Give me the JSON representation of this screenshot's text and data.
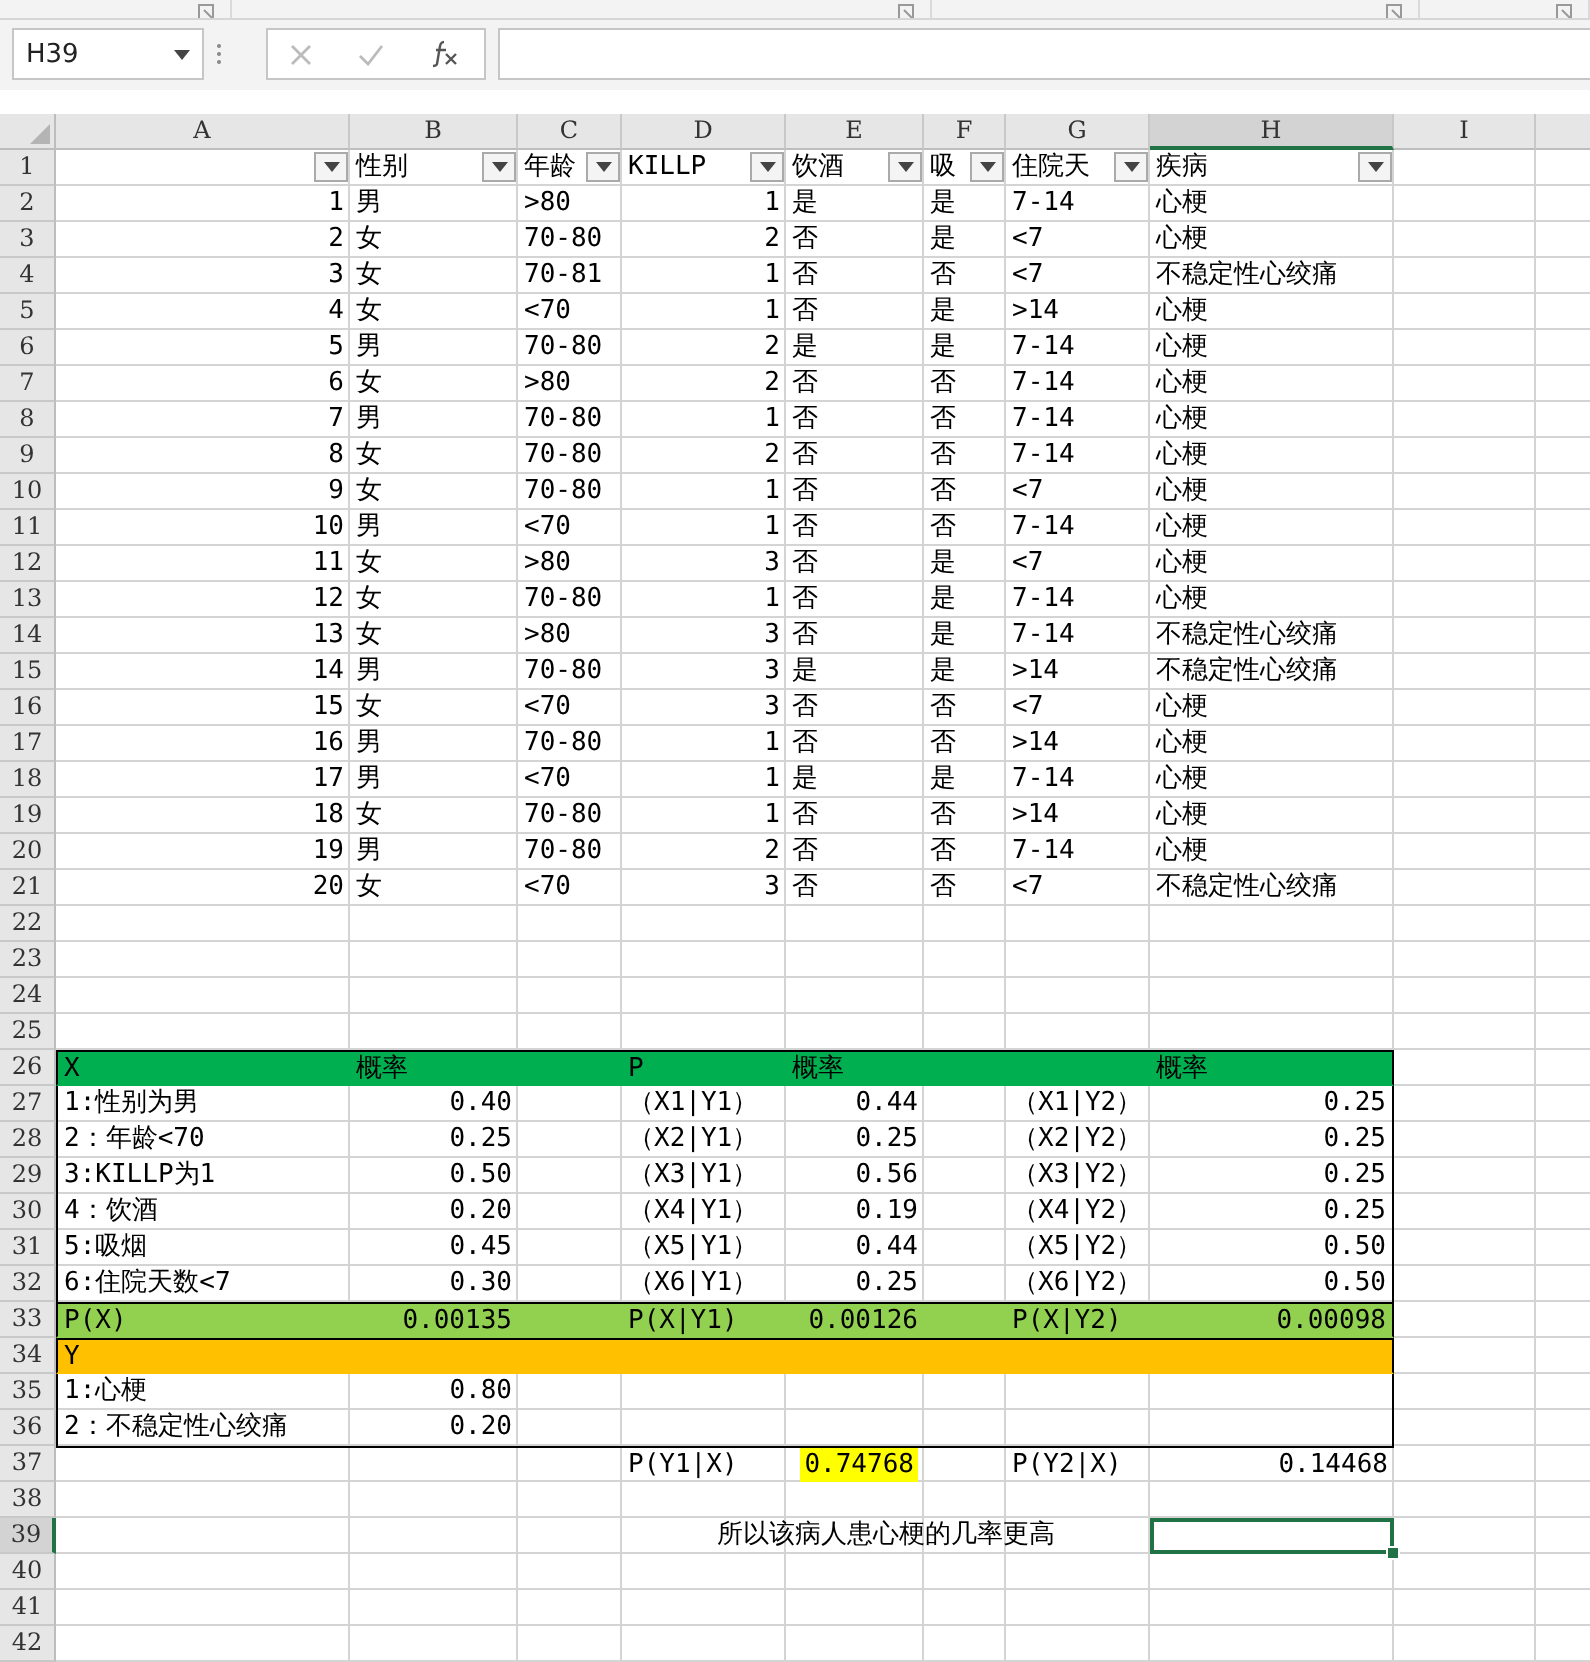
{
  "name_box": "H39",
  "columns": [
    {
      "letter": "A",
      "filter": true,
      "selected": false
    },
    {
      "letter": "B",
      "filter": true,
      "selected": false
    },
    {
      "letter": "C",
      "filter": true,
      "selected": false
    },
    {
      "letter": "D",
      "filter": true,
      "selected": false
    },
    {
      "letter": "E",
      "filter": true,
      "selected": false
    },
    {
      "letter": "F",
      "filter": true,
      "selected": false
    },
    {
      "letter": "G",
      "filter": true,
      "selected": false
    },
    {
      "letter": "H",
      "filter": true,
      "selected": true
    },
    {
      "letter": "I",
      "filter": false,
      "selected": false
    }
  ],
  "rows": [
    {
      "n": "1",
      "kind": "header",
      "selected": false,
      "cells": {
        "B": "性别",
        "C": "年龄",
        "D": "KILLP",
        "E": "饮酒",
        "F": "吸",
        "G": "住院天",
        "H": "疾病"
      }
    },
    {
      "n": "2",
      "kind": "record",
      "selected": false,
      "cells": {
        "A": "1",
        "B": "男",
        "C": ">80",
        "D": "1",
        "E": "是",
        "F": "是",
        "G": "7-14",
        "H": "心梗"
      }
    },
    {
      "n": "3",
      "kind": "record",
      "selected": false,
      "cells": {
        "A": "2",
        "B": "女",
        "C": "70-80",
        "D": "2",
        "E": "否",
        "F": "是",
        "G": "<7",
        "H": "心梗"
      }
    },
    {
      "n": "4",
      "kind": "record",
      "selected": false,
      "cells": {
        "A": "3",
        "B": "女",
        "C": "70-81",
        "D": "1",
        "E": "否",
        "F": "否",
        "G": "<7",
        "H": "不稳定性心绞痛"
      }
    },
    {
      "n": "5",
      "kind": "record",
      "selected": false,
      "cells": {
        "A": "4",
        "B": "女",
        "C": "<70",
        "D": "1",
        "E": "否",
        "F": "是",
        "G": ">14",
        "H": "心梗"
      }
    },
    {
      "n": "6",
      "kind": "record",
      "selected": false,
      "cells": {
        "A": "5",
        "B": "男",
        "C": "70-80",
        "D": "2",
        "E": "是",
        "F": "是",
        "G": "7-14",
        "H": "心梗"
      }
    },
    {
      "n": "7",
      "kind": "record",
      "selected": false,
      "cells": {
        "A": "6",
        "B": "女",
        "C": ">80",
        "D": "2",
        "E": "否",
        "F": "否",
        "G": "7-14",
        "H": "心梗"
      }
    },
    {
      "n": "8",
      "kind": "record",
      "selected": false,
      "cells": {
        "A": "7",
        "B": "男",
        "C": "70-80",
        "D": "1",
        "E": "否",
        "F": "否",
        "G": "7-14",
        "H": "心梗"
      }
    },
    {
      "n": "9",
      "kind": "record",
      "selected": false,
      "cells": {
        "A": "8",
        "B": "女",
        "C": "70-80",
        "D": "2",
        "E": "否",
        "F": "否",
        "G": "7-14",
        "H": "心梗"
      }
    },
    {
      "n": "10",
      "kind": "record",
      "selected": false,
      "cells": {
        "A": "9",
        "B": "女",
        "C": "70-80",
        "D": "1",
        "E": "否",
        "F": "否",
        "G": "<7",
        "H": "心梗"
      }
    },
    {
      "n": "11",
      "kind": "record",
      "selected": false,
      "cells": {
        "A": "10",
        "B": "男",
        "C": "<70",
        "D": "1",
        "E": "否",
        "F": "否",
        "G": "7-14",
        "H": "心梗"
      }
    },
    {
      "n": "12",
      "kind": "record",
      "selected": false,
      "cells": {
        "A": "11",
        "B": "女",
        "C": ">80",
        "D": "3",
        "E": "否",
        "F": "是",
        "G": "<7",
        "H": "心梗"
      }
    },
    {
      "n": "13",
      "kind": "record",
      "selected": false,
      "cells": {
        "A": "12",
        "B": "女",
        "C": "70-80",
        "D": "1",
        "E": "否",
        "F": "是",
        "G": "7-14",
        "H": "心梗"
      }
    },
    {
      "n": "14",
      "kind": "record",
      "selected": false,
      "cells": {
        "A": "13",
        "B": "女",
        "C": ">80",
        "D": "3",
        "E": "否",
        "F": "是",
        "G": "7-14",
        "H": "不稳定性心绞痛"
      }
    },
    {
      "n": "15",
      "kind": "record",
      "selected": false,
      "cells": {
        "A": "14",
        "B": "男",
        "C": "70-80",
        "D": "3",
        "E": "是",
        "F": "是",
        "G": ">14",
        "H": "不稳定性心绞痛"
      }
    },
    {
      "n": "16",
      "kind": "record",
      "selected": false,
      "cells": {
        "A": "15",
        "B": "女",
        "C": "<70",
        "D": "3",
        "E": "否",
        "F": "否",
        "G": "<7",
        "H": "心梗"
      }
    },
    {
      "n": "17",
      "kind": "record",
      "selected": false,
      "cells": {
        "A": "16",
        "B": "男",
        "C": "70-80",
        "D": "1",
        "E": "否",
        "F": "否",
        "G": ">14",
        "H": "心梗"
      }
    },
    {
      "n": "18",
      "kind": "record",
      "selected": false,
      "cells": {
        "A": "17",
        "B": "男",
        "C": "<70",
        "D": "1",
        "E": "是",
        "F": "是",
        "G": "7-14",
        "H": "心梗"
      }
    },
    {
      "n": "19",
      "kind": "record",
      "selected": false,
      "cells": {
        "A": "18",
        "B": "女",
        "C": "70-80",
        "D": "1",
        "E": "否",
        "F": "否",
        "G": ">14",
        "H": "心梗"
      }
    },
    {
      "n": "20",
      "kind": "record",
      "selected": false,
      "cells": {
        "A": "19",
        "B": "男",
        "C": "70-80",
        "D": "2",
        "E": "否",
        "F": "否",
        "G": "7-14",
        "H": "心梗"
      }
    },
    {
      "n": "21",
      "kind": "record",
      "selected": false,
      "cells": {
        "A": "20",
        "B": "女",
        "C": "<70",
        "D": "3",
        "E": "否",
        "F": "否",
        "G": "<7",
        "H": "不稳定性心绞痛"
      }
    },
    {
      "n": "22",
      "kind": "blank",
      "selected": false
    },
    {
      "n": "23",
      "kind": "blank",
      "selected": false
    },
    {
      "n": "24",
      "kind": "blank",
      "selected": false
    },
    {
      "n": "25",
      "kind": "blank",
      "selected": false
    },
    {
      "n": "26",
      "kind": "heading",
      "selected": false,
      "cells": {
        "A": "X",
        "B": "概率",
        "D": "P",
        "E": "概率",
        "H": "概率"
      }
    },
    {
      "n": "27",
      "kind": "stat",
      "selected": false,
      "cells": {
        "A": "1:性别为男",
        "B": "0.40",
        "D": "（X1|Y1）",
        "E": "0.44",
        "G": "（X1|Y2）",
        "H": "0.25"
      }
    },
    {
      "n": "28",
      "kind": "stat",
      "selected": false,
      "cells": {
        "A": "2：年龄<70",
        "B": "0.25",
        "D": "（X2|Y1）",
        "E": "0.25",
        "G": "（X2|Y2）",
        "H": "0.25"
      }
    },
    {
      "n": "29",
      "kind": "stat",
      "selected": false,
      "cells": {
        "A": "3:KILLP为1",
        "B": "0.50",
        "D": "（X3|Y1）",
        "E": "0.56",
        "G": "（X3|Y2）",
        "H": "0.25"
      }
    },
    {
      "n": "30",
      "kind": "stat",
      "selected": false,
      "cells": {
        "A": "4：饮酒",
        "B": "0.20",
        "D": "（X4|Y1）",
        "E": "0.19",
        "G": "（X4|Y2）",
        "H": "0.25"
      }
    },
    {
      "n": "31",
      "kind": "stat",
      "selected": false,
      "cells": {
        "A": "5:吸烟",
        "B": "0.45",
        "D": "（X5|Y1）",
        "E": "0.44",
        "G": "（X5|Y2）",
        "H": "0.50"
      }
    },
    {
      "n": "32",
      "kind": "stat",
      "selected": false,
      "cells": {
        "A": "6:住院天数<7",
        "B": "0.30",
        "D": "（X6|Y1）",
        "E": "0.25",
        "G": "（X6|Y2）",
        "H": "0.50"
      }
    },
    {
      "n": "33",
      "kind": "total",
      "selected": false,
      "cells": {
        "A": "P(X)",
        "B": "0.00135",
        "D": "P(X|Y1)",
        "E": "0.00126",
        "G": "P(X|Y2)",
        "H": "0.00098"
      }
    },
    {
      "n": "34",
      "kind": "section",
      "selected": false,
      "cells": {
        "A": "Y"
      }
    },
    {
      "n": "35",
      "kind": "stat",
      "selected": false,
      "cells": {
        "A": "1:心梗",
        "B": "0.80"
      }
    },
    {
      "n": "36",
      "kind": "stat",
      "selected": false,
      "cells": {
        "A": "2：不稳定性心绞痛",
        "B": "0.20"
      }
    },
    {
      "n": "37",
      "kind": "result",
      "selected": false,
      "cells": {
        "D": "P(Y1|X)",
        "E": {
          "text": "0.74768",
          "highlighted": true
        },
        "G": "P(Y2|X)",
        "H": "0.14468"
      }
    },
    {
      "n": "38",
      "kind": "blank",
      "selected": false
    },
    {
      "n": "39",
      "kind": "note",
      "selected": true,
      "cells": {
        "D": "所以该病人患心梗的几率更高"
      }
    },
    {
      "n": "40",
      "kind": "blank",
      "selected": false
    },
    {
      "n": "41",
      "kind": "blank",
      "selected": false
    },
    {
      "n": "42",
      "kind": "blank",
      "selected": false
    }
  ]
}
